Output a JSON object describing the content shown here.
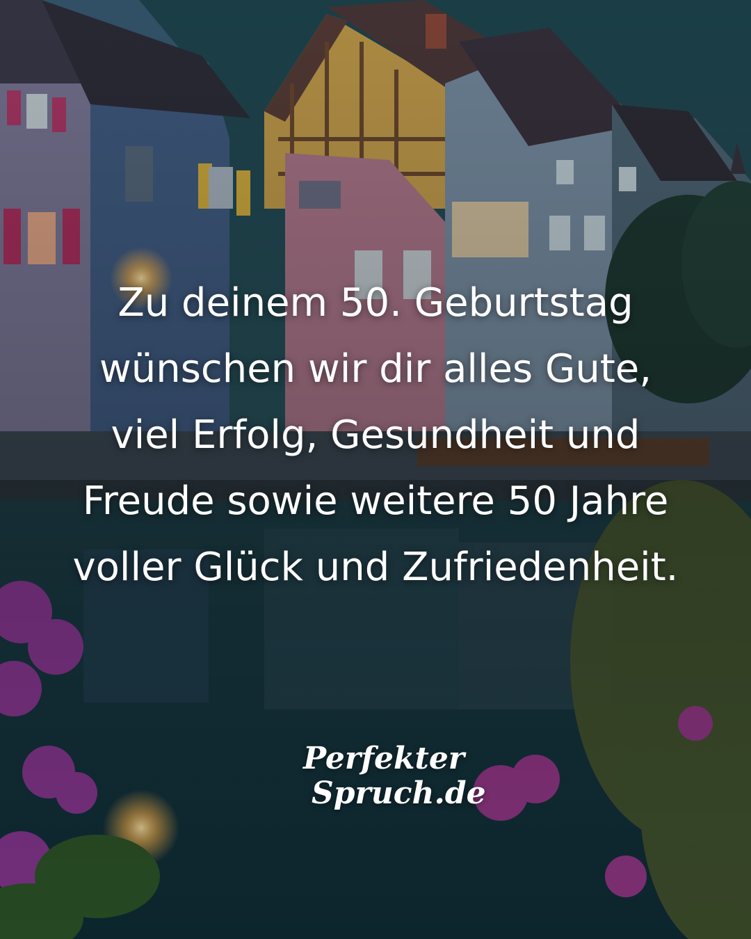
{
  "quote": {
    "lines": [
      "Zu deinem 50. Geburtstag",
      "wünschen wir dir alles Gute,",
      "viel Erfolg, Gesundheit und",
      "Freude sowie weitere 50 Jahre",
      "voller Glück und Zufriedenheit."
    ]
  },
  "logo": {
    "line1": "Perfekter",
    "line2": "Spruch.de"
  },
  "colors": {
    "sky": "#214a55",
    "water": "#153944",
    "text": "#ffffff",
    "flowers": "#a03a9a"
  }
}
